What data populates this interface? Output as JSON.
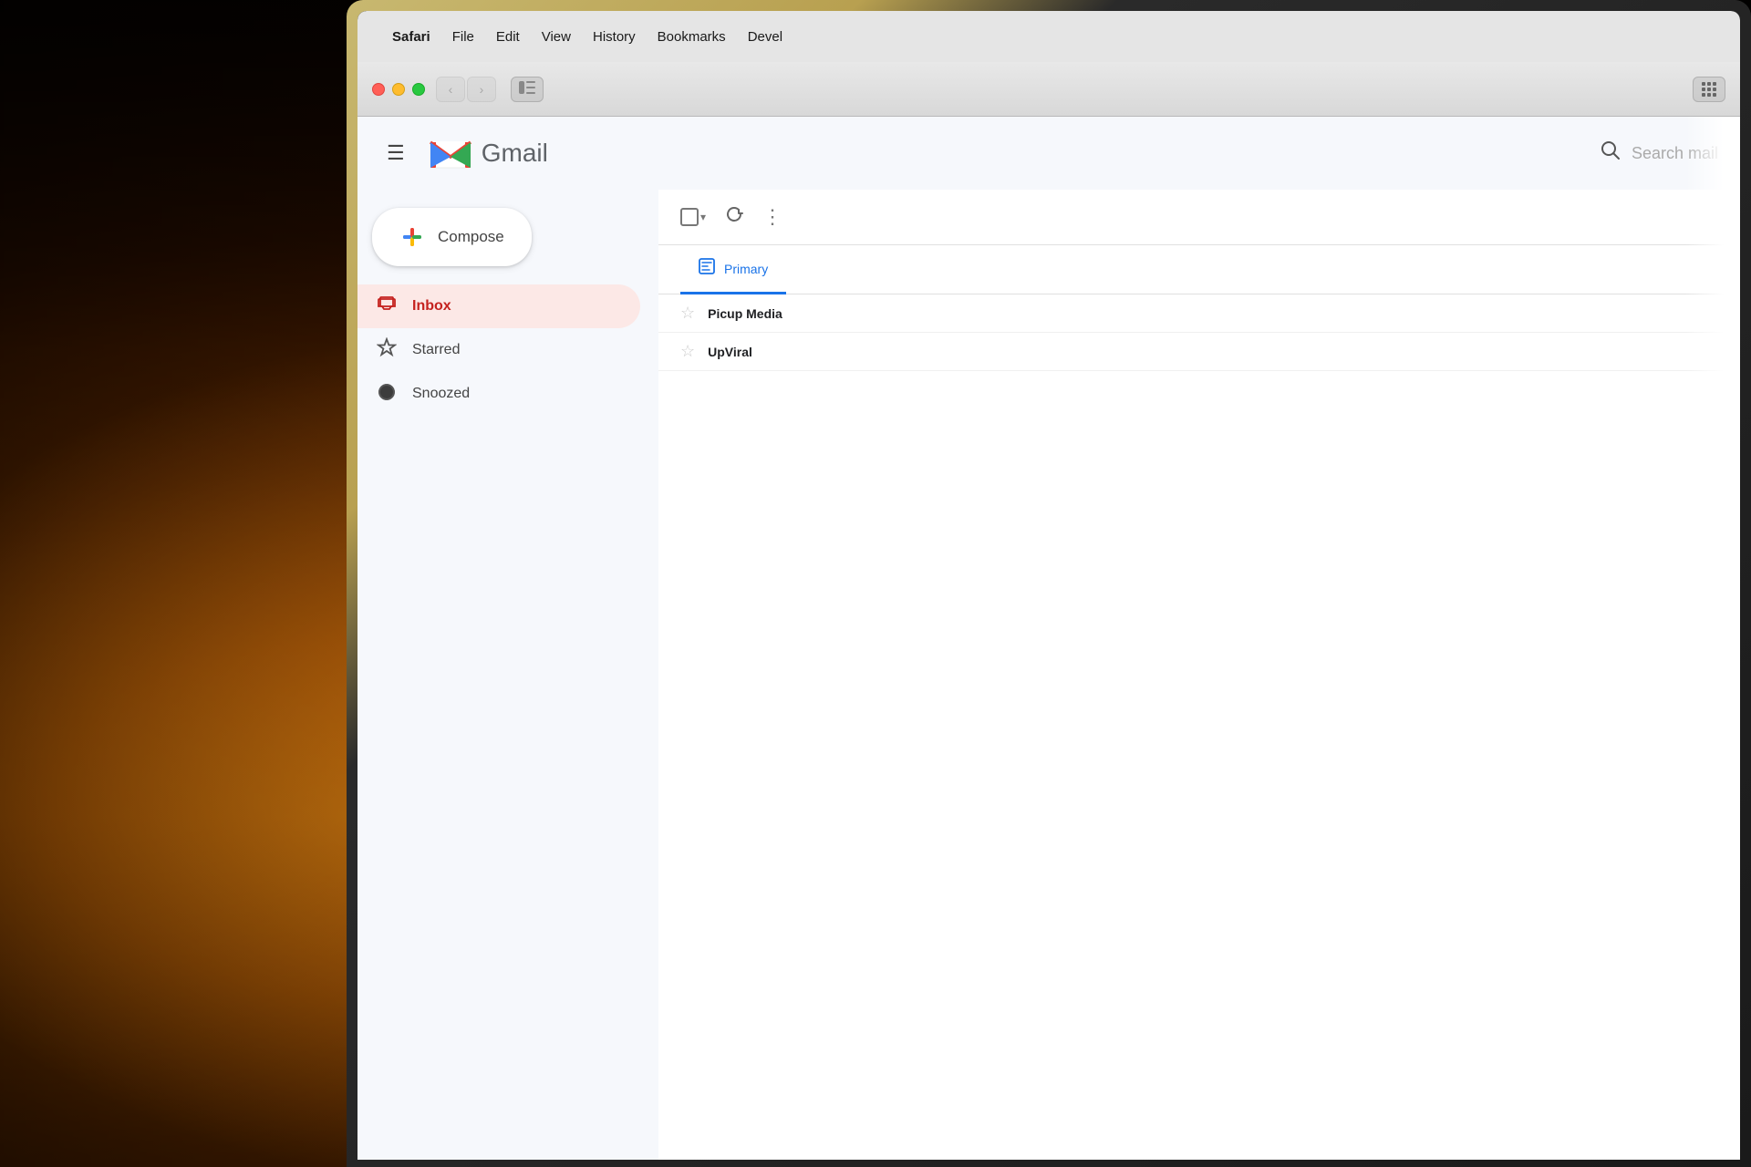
{
  "background": {
    "description": "Dark warm bokeh background with glowing light"
  },
  "macos": {
    "menu_bar": {
      "apple_symbol": "",
      "items": [
        {
          "label": "Safari",
          "bold": true
        },
        {
          "label": "File",
          "bold": false
        },
        {
          "label": "Edit",
          "bold": false
        },
        {
          "label": "View",
          "bold": false
        },
        {
          "label": "History",
          "bold": false
        },
        {
          "label": "Bookmarks",
          "bold": false
        },
        {
          "label": "Devel",
          "bold": false
        }
      ]
    },
    "traffic_lights": {
      "red": "#ff5f57",
      "yellow": "#febc2e",
      "green": "#28c840"
    }
  },
  "safari": {
    "back_btn": "‹",
    "forward_btn": "›",
    "sidebar_icon": "⊡"
  },
  "gmail": {
    "header": {
      "menu_icon": "☰",
      "logo_text": "Gmail",
      "search_placeholder": "Search mail"
    },
    "compose": {
      "label": "Compose"
    },
    "sidebar": {
      "items": [
        {
          "id": "inbox",
          "label": "Inbox",
          "active": true
        },
        {
          "id": "starred",
          "label": "Starred",
          "active": false
        },
        {
          "id": "snoozed",
          "label": "Snoozed",
          "active": false
        }
      ]
    },
    "toolbar": {
      "more_label": "⋮"
    },
    "tabs": [
      {
        "id": "primary",
        "label": "Primary",
        "active": true
      }
    ],
    "emails": [
      {
        "sender": "Picup Media",
        "preview": "",
        "starred": false
      },
      {
        "sender": "UpViral",
        "preview": "",
        "starred": false
      }
    ]
  }
}
